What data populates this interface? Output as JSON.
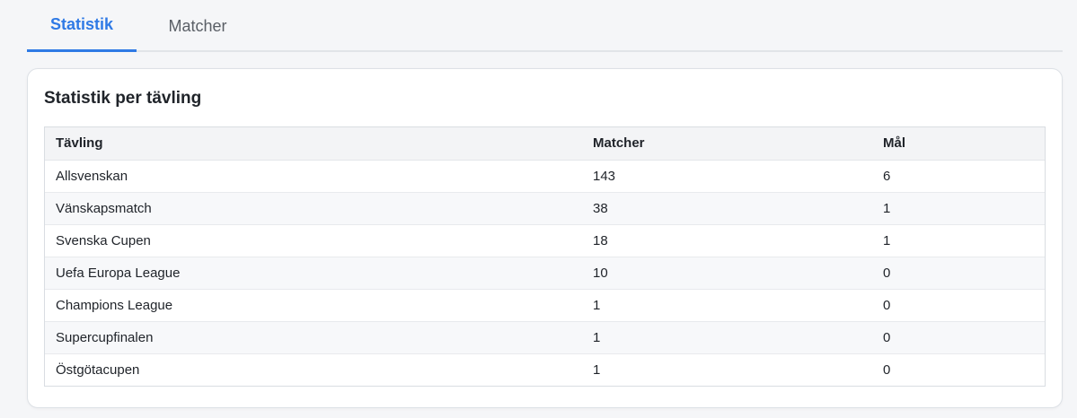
{
  "tabs": [
    {
      "label": "Statistik",
      "active": true
    },
    {
      "label": "Matcher",
      "active": false
    }
  ],
  "card": {
    "title": "Statistik per tävling"
  },
  "table": {
    "headers": [
      "Tävling",
      "Matcher",
      "Mål"
    ],
    "rows": [
      [
        "Allsvenskan",
        "143",
        "6"
      ],
      [
        "Vänskapsmatch",
        "38",
        "1"
      ],
      [
        "Svenska Cupen",
        "18",
        "1"
      ],
      [
        "Uefa Europa League",
        "10",
        "0"
      ],
      [
        "Champions League",
        "1",
        "0"
      ],
      [
        "Supercupfinalen",
        "1",
        "0"
      ],
      [
        "Östgötacupen",
        "1",
        "0"
      ]
    ]
  },
  "colors": {
    "accent": "#2f7ae5",
    "text": "#1f2329",
    "muted": "#5a5f66"
  }
}
